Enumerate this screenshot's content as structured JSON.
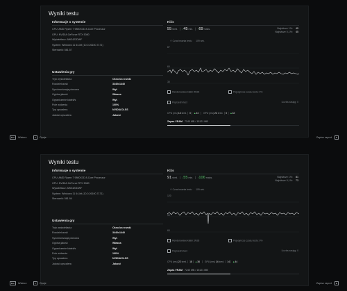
{
  "screens": [
    {
      "title": "Wyniki testu",
      "system": {
        "header": "Informacje o systemie",
        "cpu": "CPU: AMD Ryzen 7 9800X3D 8-Core Processor",
        "gpu": "GPU: NVIDIA GeForce RTX 5080",
        "display": "Wyświetlacz: AW3423DWF",
        "os": "System: Windows 11 64-bit (10.0.26100.7171)",
        "driver": "Sterownik: 581.57"
      },
      "settings_header": "Ustawienia gry",
      "settings": [
        {
          "k": "Tryb wyświetlania",
          "v": "Okno bez ramki"
        },
        {
          "k": "Rozdzielczość",
          "v": "3440x1440"
        },
        {
          "k": "Synchronizacja pionowa",
          "v": "Wył."
        },
        {
          "k": "Ogólna jakość",
          "v": "Własna"
        },
        {
          "k": "Ograniczenie klatek/s",
          "v": "Wył."
        },
        {
          "k": "Pole widzenia",
          "v": "100%"
        },
        {
          "k": "Typ upscalera",
          "v": "NVIDIA DLSS"
        },
        {
          "k": "Jakość upscalera",
          "v": "Jakość"
        }
      ],
      "fps": {
        "header": "Kl./s",
        "avg": "55",
        "avg_label": "śred.",
        "min": "45",
        "min_label": "min.",
        "max": "69",
        "max_label": "maks.",
        "low1_label": "Najniższe 1%:",
        "low1": "45",
        "low01_label": "Najniższe 0,1%:",
        "low01": "45"
      },
      "frametime": {
        "label": "Czas trwania testu",
        "value": "109 sek."
      },
      "graph_top": "87",
      "graph_mid": "60",
      "graph_bot": "30",
      "rendered": {
        "label": "Renderowane klatki",
        "value": "5926",
        "gen_label": "Pojedyncze czasu testu",
        "gen_value": "0%"
      },
      "latency": {
        "label": "Poprzedni test",
        "right": "Liczba zasięg: 0"
      },
      "cpu_stats": {
        "label": "CPU (ms)",
        "avg": "13",
        "a1": "0",
        "a2": "44"
      },
      "gpu_stats": {
        "label": "GPU (ms)",
        "avg": "22",
        "a1": "0",
        "a2": "42"
      },
      "vram": {
        "label": "Zapas VRAM",
        "value": "7240 MB / 15121 MB",
        "fill": 0.48
      }
    },
    {
      "title": "Wyniki testu",
      "system": {
        "header": "Informacje o systemie",
        "cpu": "CPU: AMD Ryzen 7 9800X3D 8-Core Processor",
        "gpu": "GPU: NVIDIA GeForce RTX 5080",
        "display": "Wyświetlacz: AW3423DWF",
        "os": "System: Windows 11 64-bit (10.0.26100.7171)",
        "driver": "Sterownik: 581.94"
      },
      "settings_header": "Ustawienia gry",
      "settings": [
        {
          "k": "Tryb wyświetlania",
          "v": "Okno bez ramki"
        },
        {
          "k": "Rozdzielczość",
          "v": "3440x1440"
        },
        {
          "k": "Synchronizacja pionowa",
          "v": "Wył."
        },
        {
          "k": "Ogólna jakość",
          "v": "Własna"
        },
        {
          "k": "Ograniczenie klatek/s",
          "v": "Wył."
        },
        {
          "k": "Pole widzenia",
          "v": "100%"
        },
        {
          "k": "Typ upscalera",
          "v": "NVIDIA DLSS"
        },
        {
          "k": "Jakość upscalera",
          "v": "Jakość"
        }
      ],
      "fps": {
        "header": "Kl./s",
        "avg": "91",
        "avg_label": "śred.",
        "min": "55",
        "min_label": "min.",
        "max": "106",
        "max_label": "maks.",
        "low1_label": "Najniższe 1%:",
        "low1": "81",
        "low01_label": "Najniższe 0,1%:",
        "low01": "73"
      },
      "frametime": {
        "label": "Czas trwania testu",
        "value": "109 sek."
      },
      "graph_top": "120",
      "graph_mid": "90",
      "graph_bot": "60",
      "rendered": {
        "label": "Renderowane klatki",
        "value": "9928",
        "gen_label": "Pojedyncze czasu testu",
        "gen_value": "0%"
      },
      "latency": {
        "label": "Poprzedni test",
        "right": "Liczba zasięg: 0"
      },
      "cpu_stats": {
        "label": "CPU (ms)",
        "avg": "22",
        "a1": "18",
        "a2": "36"
      },
      "gpu_stats": {
        "label": "GPU (ms)",
        "avg": "14",
        "a1": "14",
        "a2": "44"
      },
      "vram": {
        "label": "Zapas VRAM",
        "value": "7240 MB / 15121 MB",
        "fill": 0.48
      }
    }
  ],
  "footer": {
    "back_key": "Esc",
    "back_label": "Wstecz",
    "options_key": "F",
    "options_label": "Opcje",
    "report_label": "Zapisz raport",
    "report_key": "E"
  }
}
